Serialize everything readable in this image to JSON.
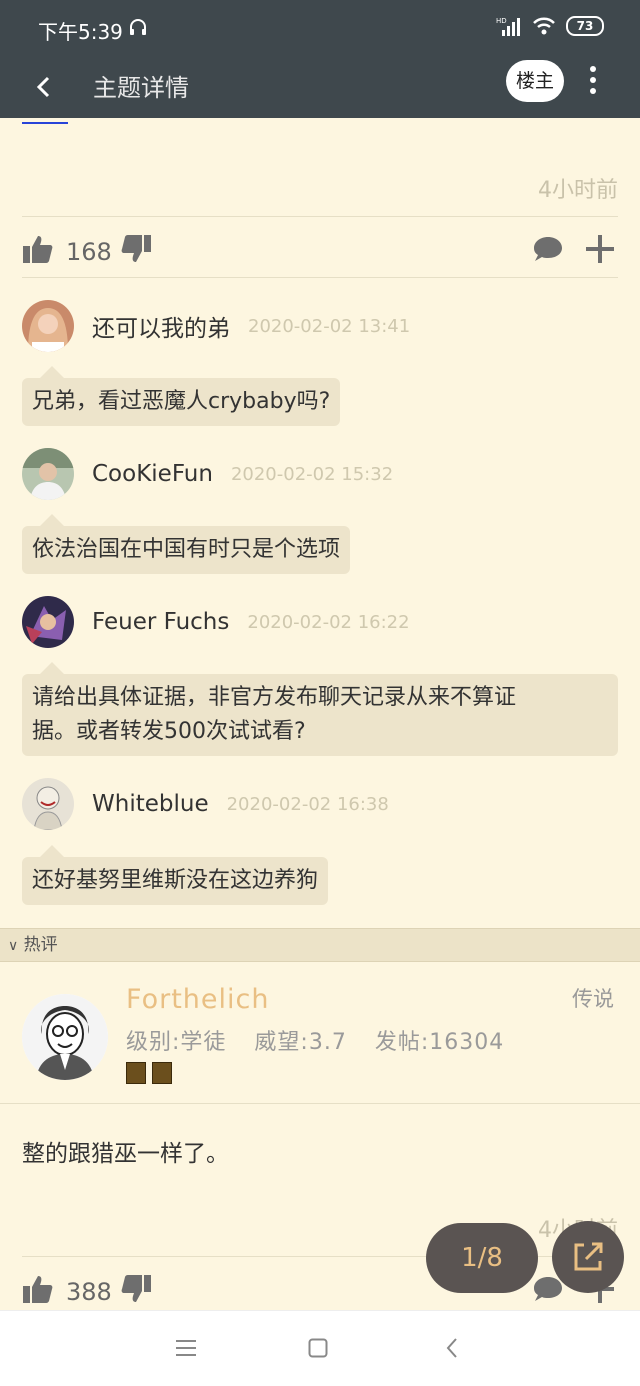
{
  "status_bar": {
    "time": "下午5:39",
    "network": "HD",
    "battery": "73"
  },
  "app_bar": {
    "title": "主题详情",
    "owner_button": "楼主",
    "icons": [
      "back-arrow-icon",
      "more-vert-icon"
    ]
  },
  "main_post": {
    "time_ago": "4小时前",
    "like_count": "168"
  },
  "comments": [
    {
      "name": "还可以我的弟",
      "date": "2020-02-02 13:41",
      "text": "兄弟，看过恶魔人crybaby吗?"
    },
    {
      "name": "CooKieFun",
      "date": "2020-02-02 15:32",
      "text": "依法治国在中国有时只是个选项"
    },
    {
      "name": "Feuer Fuchs",
      "date": "2020-02-02 16:22",
      "text_line1": "请给出具体证据，非官方发布聊天记录从来不算证",
      "text_line2": "据。或者转发500次试试看?"
    },
    {
      "name": "Whiteblue",
      "date": "2020-02-02 16:38",
      "text": "还好基努里维斯没在这边养狗"
    }
  ],
  "hot_section": {
    "label": "热评"
  },
  "hot_post": {
    "user_name": "Forthelich",
    "level": "级别:学徒",
    "reputation": "威望:3.7",
    "post_count": "发帖:16304",
    "rank": "传说",
    "body": "整的跟猎巫一样了。",
    "time_ago": "4小时前",
    "like_count": "388"
  },
  "pager": {
    "label": "1/8"
  },
  "colors": {
    "header_bg": "#3f484d",
    "page_bg": "#fdf6e0",
    "bubble_bg": "#ede4cb",
    "accent": "#e9bf83"
  }
}
